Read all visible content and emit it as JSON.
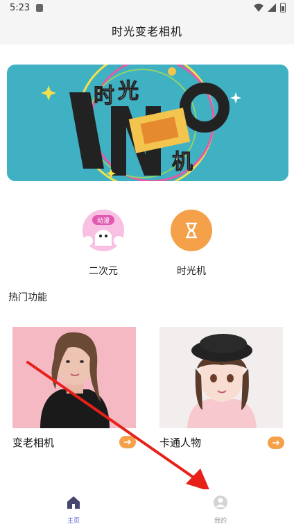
{
  "status_bar": {
    "time": "5:23"
  },
  "header": {
    "title": "时光变老相机"
  },
  "categories": [
    {
      "label": "二次元",
      "badge": "动漫"
    },
    {
      "label": "时光机"
    }
  ],
  "section": {
    "title": "热门功能"
  },
  "features": [
    {
      "title": "变老相机"
    },
    {
      "title": "卡通人物"
    }
  ],
  "tabs": [
    {
      "label": "主页",
      "active": true
    },
    {
      "label": "我的",
      "active": false
    }
  ],
  "colors": {
    "accent": "#f5a14a",
    "banner": "#3fb1c2",
    "tab_active": "#5b5bd6",
    "annotation": "#e8201a"
  }
}
